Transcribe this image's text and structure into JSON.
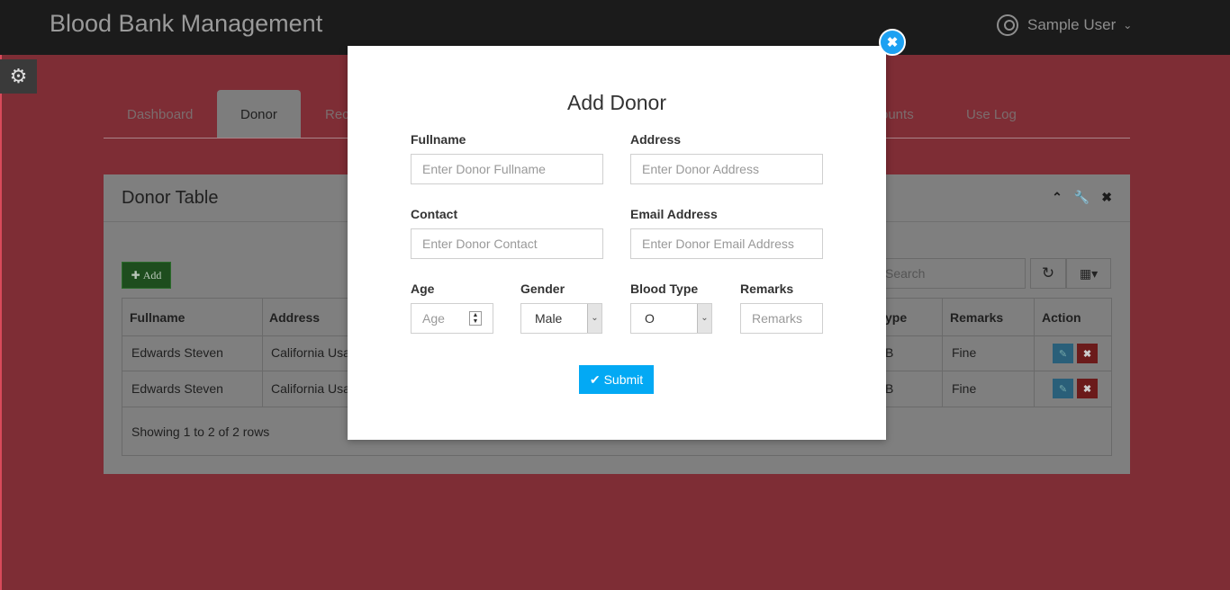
{
  "app": {
    "title": "Blood Bank Management",
    "user_name": "Sample User"
  },
  "nav": {
    "tabs": [
      {
        "label": "Dashboard"
      },
      {
        "label": "Donor"
      },
      {
        "label": "Rec"
      },
      {
        "label": "ounts"
      },
      {
        "label": "Use Log"
      }
    ]
  },
  "panel": {
    "title": "Donor Table",
    "add_label": "Add",
    "search_placeholder": "Search",
    "columns": [
      "Fullname",
      "Address",
      "ype",
      "Remarks",
      "Action"
    ],
    "rows": [
      {
        "fullname": "Edwards Steven",
        "address": "California Usa",
        "type": "B",
        "remarks": "Fine"
      },
      {
        "fullname": "Edwards Steven",
        "address": "California Usa",
        "type": "B",
        "remarks": "Fine"
      }
    ],
    "footer": "Showing 1 to 2 of 2 rows"
  },
  "modal": {
    "title": "Add Donor",
    "fullname_label": "Fullname",
    "fullname_placeholder": "Enter Donor Fullname",
    "address_label": "Address",
    "address_placeholder": "Enter Donor Address",
    "contact_label": "Contact",
    "contact_placeholder": "Enter Donor Contact",
    "email_label": "Email Address",
    "email_placeholder": "Enter Donor Email Address",
    "age_label": "Age",
    "age_placeholder": "Age",
    "gender_label": "Gender",
    "gender_value": "Male",
    "blood_type_label": "Blood Type",
    "blood_type_value": "O",
    "remarks_label": "Remarks",
    "remarks_placeholder": "Remarks",
    "submit_label": "Submit"
  },
  "colors": {
    "topbar": "#1b1b1b",
    "overlay_page": "#7e2d35",
    "submit": "#03a9f4",
    "close": "#1da1f2"
  }
}
